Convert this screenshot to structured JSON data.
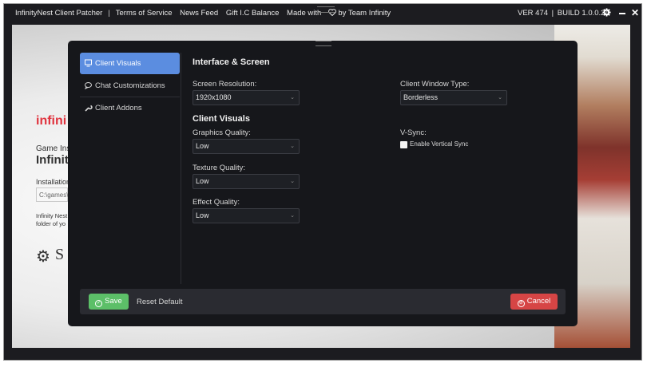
{
  "topbar": {
    "app_title": "InfinityNest Client Patcher",
    "separator": "|",
    "terms": "Terms of Service",
    "news": "News Feed",
    "gift": "Gift I.C Balance",
    "made_with": "Made with",
    "by_team": "by Team Infinity",
    "version": "VER 474",
    "build": "BUILD 1.0.0.24"
  },
  "background": {
    "brand": "infini",
    "game_ins": "Game Ins",
    "infinit": "Infinit",
    "installation": "Installation",
    "path": "C:\\games\\",
    "desc1": "Infinity Nest",
    "desc2": "folder of yo",
    "s_letter": "S"
  },
  "sidebar": {
    "items": [
      {
        "label": "Client Visuals",
        "icon": "monitor-icon"
      },
      {
        "label": "Chat Customizations",
        "icon": "chat-bubble-icon"
      },
      {
        "label": "Client Addons",
        "icon": "wrench-icon"
      }
    ]
  },
  "settings": {
    "section1_title": "Interface & Screen",
    "resolution_label": "Screen Resolution:",
    "resolution_value": "1920x1080",
    "window_type_label": "Client Window Type:",
    "window_type_value": "Borderless",
    "section2_title": "Client Visuals",
    "graphics_label": "Graphics Quality:",
    "graphics_value": "Low",
    "vsync_label": "V-Sync:",
    "vsync_checkbox_label": "Enable Vertical Sync",
    "vsync_checked": false,
    "texture_label": "Texture Quality:",
    "texture_value": "Low",
    "effect_label": "Effect Quality:",
    "effect_value": "Low"
  },
  "footer": {
    "save": "Save",
    "reset": "Reset Default",
    "cancel": "Cancel"
  },
  "colors": {
    "accent": "#5b8de0",
    "save": "#5cbf68",
    "cancel": "#d64545",
    "modal_bg": "#16171b"
  }
}
